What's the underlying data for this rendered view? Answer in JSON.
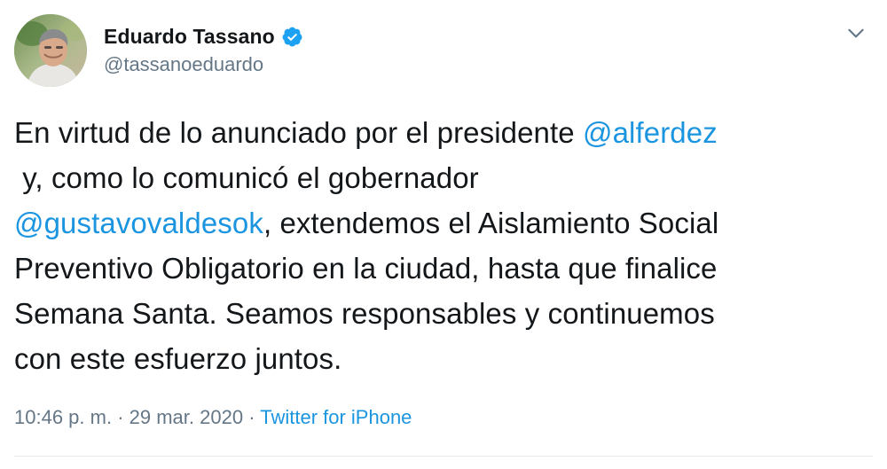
{
  "author": {
    "display_name": "Eduardo Tassano",
    "handle": "@tassanoeduardo",
    "verified": true,
    "avatar": "profile-photo"
  },
  "tweet": {
    "lines": [
      [
        {
          "text": "En virtud de lo anunciado por el presidente "
        },
        {
          "text": "@alferdez",
          "mention": true
        }
      ],
      [
        {
          "text": " y, como lo comunicó el gobernador"
        }
      ],
      [
        {
          "text": "@gustavovaldesok",
          "mention": true
        },
        {
          "text": ", extendemos el Aislamiento Social"
        }
      ],
      [
        {
          "text": "Preventivo Obligatorio en la ciudad, hasta que finalice"
        }
      ],
      [
        {
          "text": "Semana Santa. Seamos responsables y continuemos"
        }
      ],
      [
        {
          "text": "con este esfuerzo juntos."
        }
      ]
    ]
  },
  "meta": {
    "time": "10:46 p. m.",
    "separator": " · ",
    "date": "29 mar. 2020",
    "source": "Twitter for iPhone"
  },
  "colors": {
    "link": "#1b95e0",
    "secondary": "#657786",
    "text": "#14171a"
  },
  "icons": {
    "verified": "verified-badge-icon",
    "menu": "chevron-down-icon"
  }
}
